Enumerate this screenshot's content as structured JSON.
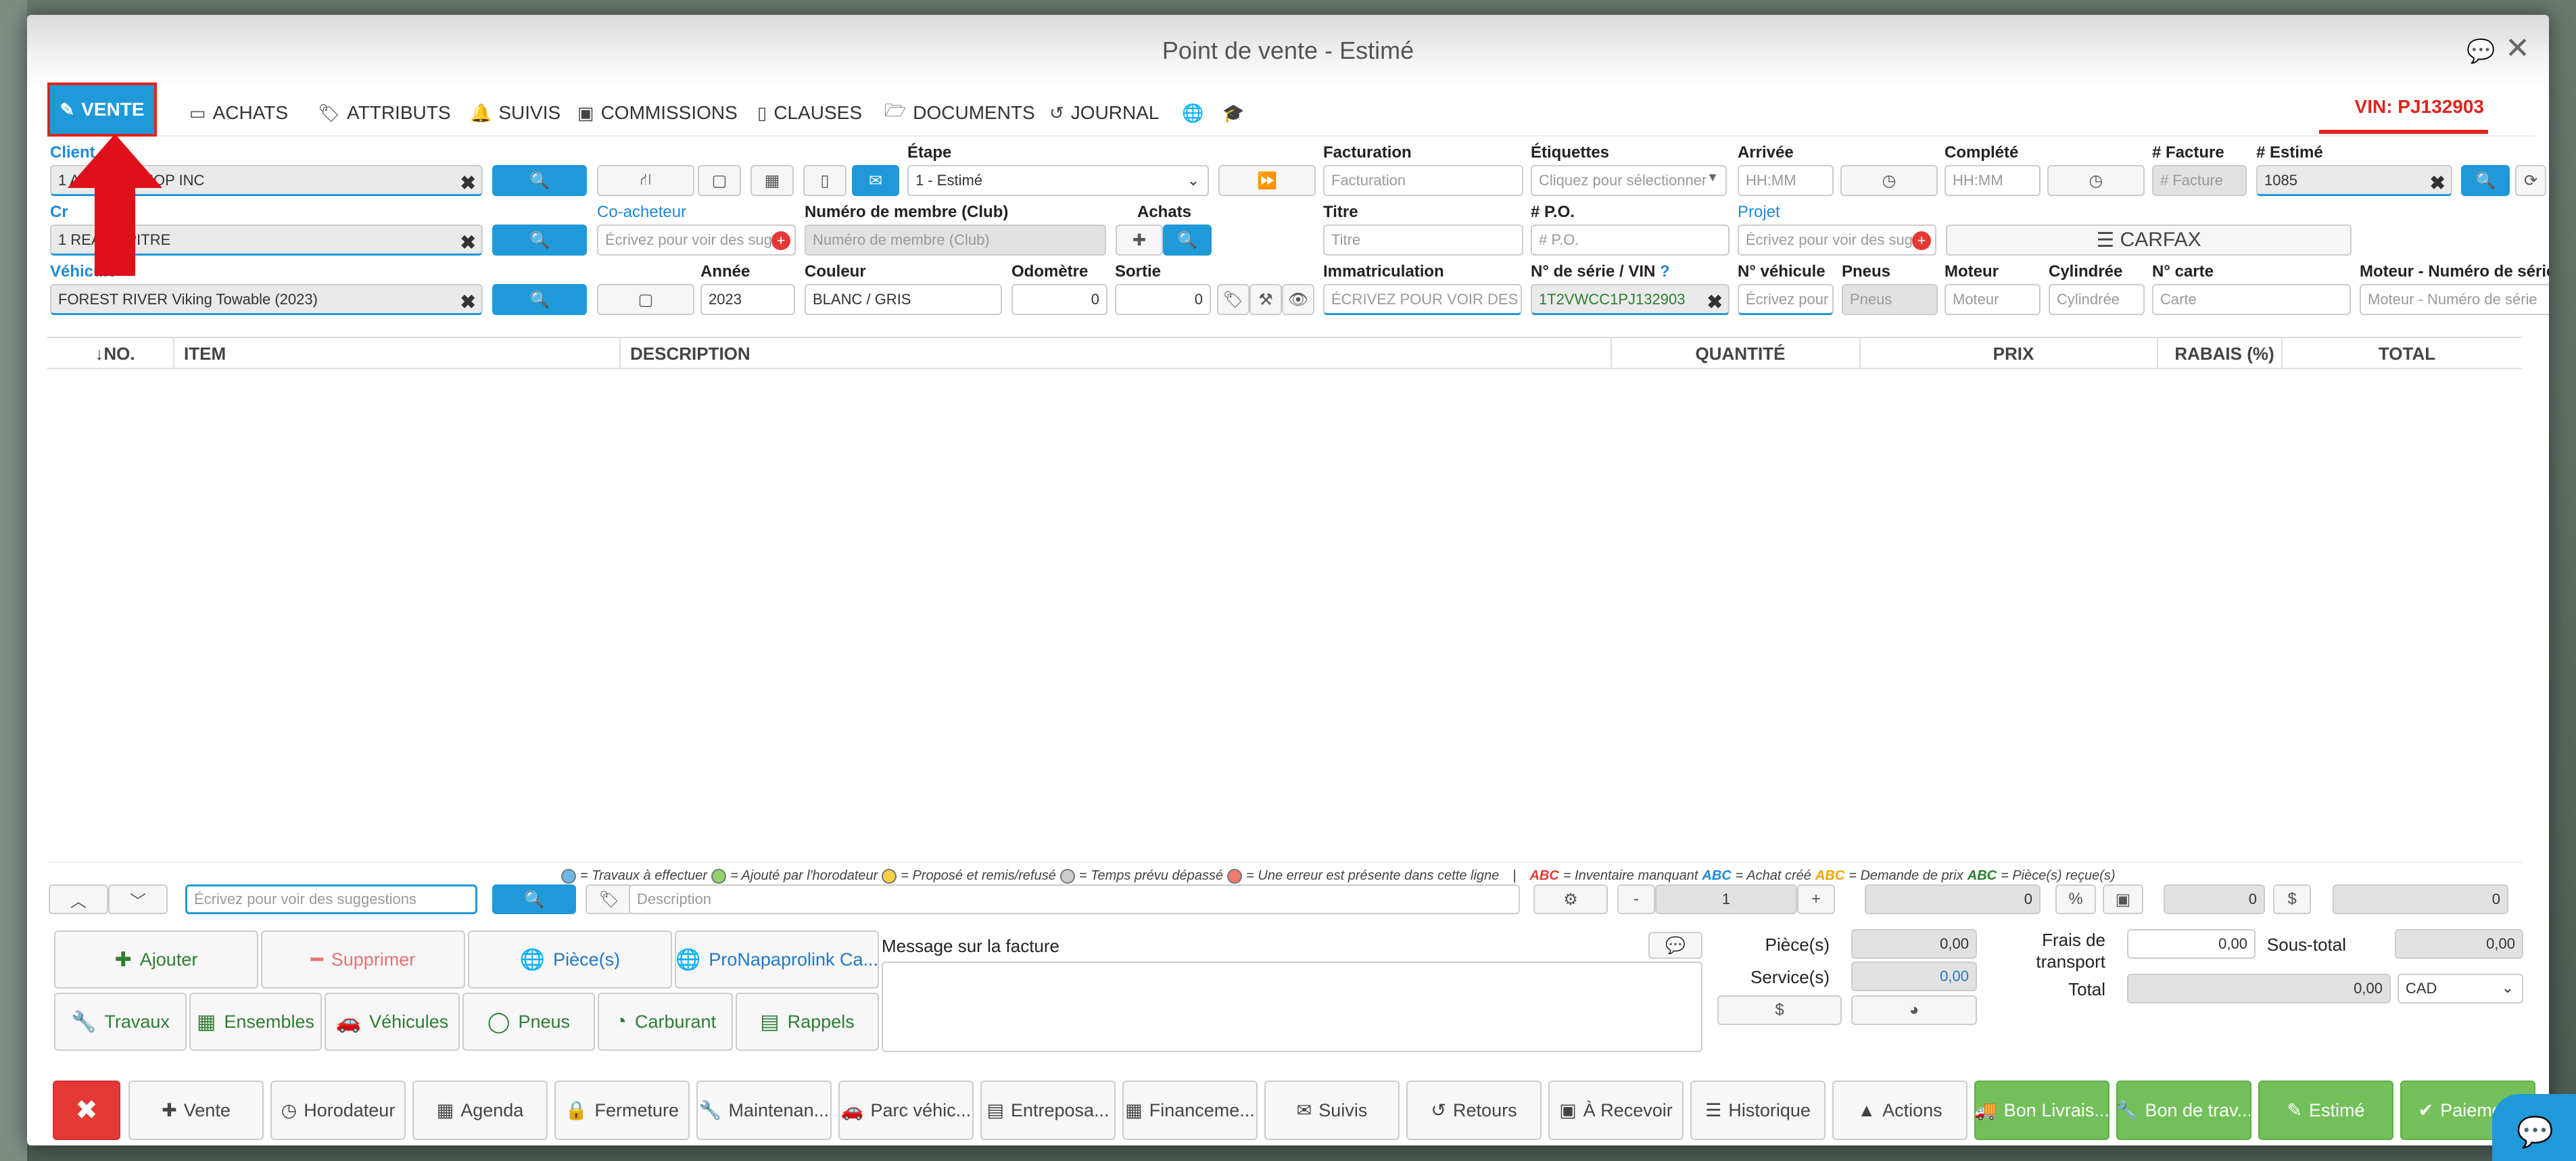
{
  "window": {
    "title": "Point de vente - Estimé"
  },
  "tabs": [
    {
      "label": "VENTE",
      "icon": "edit-icon"
    },
    {
      "label": "ACHATS",
      "icon": "card-icon"
    },
    {
      "label": "ATTRIBUTS",
      "icon": "tags-icon"
    },
    {
      "label": "SUIVIS",
      "icon": "bell-icon"
    },
    {
      "label": "COMMISSIONS",
      "icon": "money-icon"
    },
    {
      "label": "CLAUSES",
      "icon": "file-icon"
    },
    {
      "label": "DOCUMENTS",
      "icon": "folder-icon"
    },
    {
      "label": "JOURNAL",
      "icon": "history-icon"
    }
  ],
  "vin_badge": "VIN: PJ132903",
  "labels": {
    "client": "Client",
    "cr": "Cr",
    "vehicule": "Véhicule",
    "co_acheteur": "Co-acheteur",
    "numero_membre": "Numéro de membre (Club)",
    "achats": "Achats",
    "etape": "Étape",
    "annee": "Année",
    "couleur": "Couleur",
    "odometre": "Odomètre",
    "sortie": "Sortie",
    "facturation": "Facturation",
    "etiquettes": "Étiquettes",
    "arrivee": "Arrivée",
    "complete": "Complété",
    "num_facture": "# Facture",
    "num_estime": "# Estimé",
    "titre": "Titre",
    "po": "# P.O.",
    "projet": "Projet",
    "immatriculation": "Immatriculation",
    "serie_vin": "N° de série / VIN",
    "num_vehicule": "N° véhicule",
    "pneus": "Pneus",
    "moteur": "Moteur",
    "cylindree": "Cylindrée",
    "num_carte": "N° carte",
    "moteur_serie": "Moteur - Numéro de série"
  },
  "fields": {
    "client_value": "1 ARAVAN SHOP INC",
    "cr_value": "1 REANN PITRE",
    "vehicule_value": "FOREST RIVER Viking Towable (2023)",
    "co_acheteur_ph": "Écrivez pour voir des sugg",
    "numero_membre_ph": "Numéro de membre (Club)",
    "etape_value": "1 - Estimé",
    "annee_value": "2023",
    "couleur_value": "BLANC / GRIS",
    "odometre_value": "0",
    "sortie_value": "0",
    "facturation_ph": "Facturation",
    "etiquettes_ph": "Cliquez pour sélectionner",
    "arrivee_ph": "HH:MM",
    "complete_ph": "HH:MM",
    "num_facture_ph": "# Facture",
    "num_estime_value": "1085",
    "titre_ph": "Titre",
    "po_ph": "# P.O.",
    "projet_ph": "Écrivez pour voir des sugg",
    "carfax": "CARFAX",
    "immatriculation_ph": "ÉCRIVEZ POUR VOIR DES SU",
    "vin_value": "1T2VWCC1PJ132903",
    "num_vehicule_ph": "Écrivez pour",
    "pneus_ph": "Pneus",
    "moteur_ph": "Moteur",
    "cylindree_ph": "Cylindrée",
    "carte_ph": "Carte",
    "moteur_serie_ph": "Moteur - Numéro de série"
  },
  "table": {
    "columns": [
      "↓NO.",
      "ITEM",
      "DESCRIPTION",
      "QUANTITÉ",
      "PRIX",
      "RABAIS (%)",
      "TOTAL"
    ]
  },
  "legend": {
    "travaux": "= Travaux à effectuer",
    "horodateur": "= Ajouté par l'horodateur",
    "propose": "= Proposé et remis/refusé",
    "temps": "= Temps prévu dépassé",
    "erreur": "= Une erreur est présente dans cette ligne",
    "sep": "|",
    "abc": "ABC",
    "inv": "= Inventaire manquant",
    "achat": "= Achat créé",
    "prix": "= Demande de prix",
    "piece": "= Pièce(s) reçue(s)",
    "colors": {
      "travaux": "#6ab7e8",
      "horodateur": "#8fd16a",
      "propose": "#f2d04a",
      "temps": "#cccccc",
      "erreur": "#f07a6e"
    }
  },
  "entry": {
    "search_ph": "Écrivez pour voir des suggestions",
    "description_ph": "Description",
    "minus": "-",
    "qty": "1",
    "plus": "+",
    "price": "0",
    "pct": "%",
    "discount": "0",
    "dollar": "$",
    "total": "0"
  },
  "actions": {
    "ajouter": "Ajouter",
    "supprimer": "Supprimer",
    "pieces": "Pièce(s)",
    "pronapa": "ProNapaprolink Ca...",
    "travaux": "Travaux",
    "ensembles": "Ensembles",
    "vehicules": "Véhicules",
    "pneus": "Pneus",
    "carburant": "Carburant",
    "rappels": "Rappels"
  },
  "message": {
    "label": "Message sur la facture"
  },
  "summary": {
    "pieces_label": "Pièce(s)",
    "pieces_value": "0,00",
    "service_label": "Service(s)",
    "service_value": "0,00",
    "frais_label_1": "Frais de",
    "frais_label_2": "transport",
    "frais_value": "0,00",
    "soustotal_label": "Sous-total",
    "soustotal_value": "0,00",
    "total_label": "Total",
    "total_value": "0,00",
    "currency": "CAD",
    "dollar": "$"
  },
  "footer": [
    {
      "label": "✖",
      "icon": ""
    },
    {
      "label": "Vente",
      "icon": "✚"
    },
    {
      "label": "Horodateur",
      "icon": "◷"
    },
    {
      "label": "Agenda",
      "icon": "▦"
    },
    {
      "label": "Fermeture",
      "icon": "🔒"
    },
    {
      "label": "Maintenan...",
      "icon": "🔧"
    },
    {
      "label": "Parc véhic...",
      "icon": "🚗"
    },
    {
      "label": "Entreposa...",
      "icon": "▤"
    },
    {
      "label": "Financeme...",
      "icon": "▦"
    },
    {
      "label": "Suivis",
      "icon": "✉"
    },
    {
      "label": "Retours",
      "icon": "↺"
    },
    {
      "label": "À Recevoir",
      "icon": "▣"
    },
    {
      "label": "Historique",
      "icon": "☰"
    },
    {
      "label": "Actions",
      "icon": "▲"
    },
    {
      "label": "Bon Livrais...",
      "icon": "🚚"
    },
    {
      "label": "Bon de trav...",
      "icon": "🔧"
    },
    {
      "label": "Estimé",
      "icon": "✎"
    },
    {
      "label": "Paieme...",
      "icon": "✔"
    }
  ]
}
